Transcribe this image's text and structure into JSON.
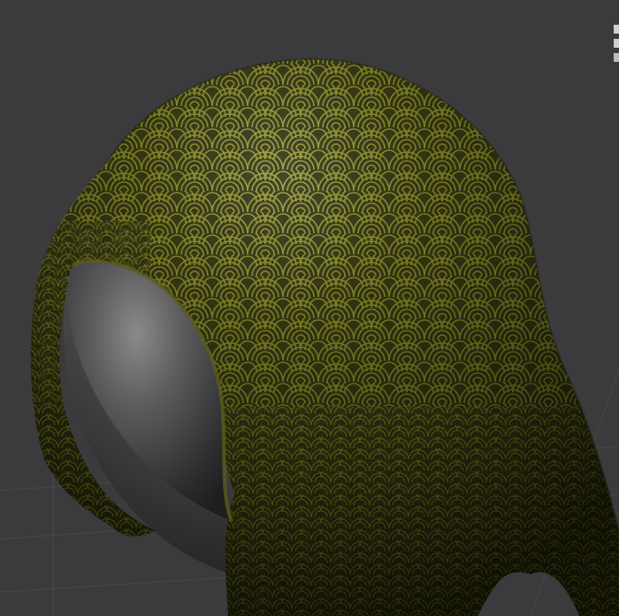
{
  "scene": {
    "description_icon": "3d-viewport",
    "background_color": "#3a3a3c",
    "grid_color": "#4a4a4d",
    "sphere_color": "#5a5a5c",
    "fabric_color": "#7a7d2a",
    "fabric_highlight": "#c9cc7a",
    "corner_icon": "viewport-gizmo-icon"
  }
}
